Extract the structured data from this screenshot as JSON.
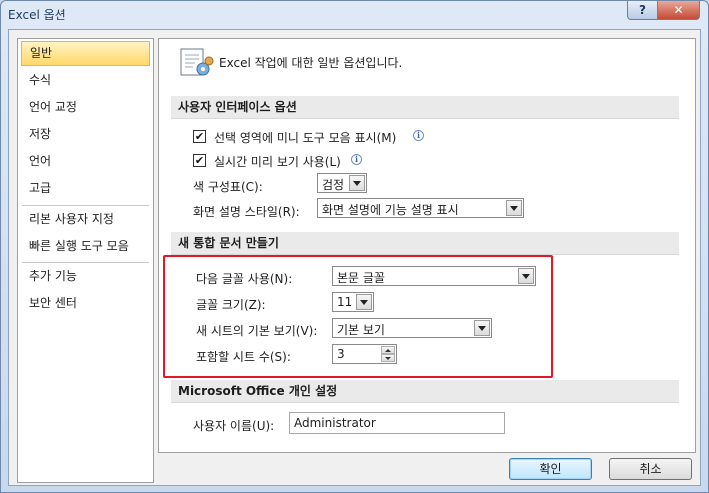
{
  "window": {
    "title": "Excel 옵션",
    "help_label": "?",
    "close_label": "✕"
  },
  "sidebar": {
    "items": [
      {
        "label": "일반",
        "selected": true
      },
      {
        "label": "수식"
      },
      {
        "label": "언어 교정"
      },
      {
        "label": "저장"
      },
      {
        "label": "언어"
      },
      {
        "label": "고급"
      },
      {
        "label": "리본 사용자 지정"
      },
      {
        "label": "빠른 실행 도구 모음"
      },
      {
        "label": "추가 기능"
      },
      {
        "label": "보안 센터"
      }
    ]
  },
  "main": {
    "intro": "Excel 작업에 대한 일반 옵션입니다.",
    "ui_section": {
      "title": "사용자 인터페이스 옵션",
      "mini_toolbar": {
        "label": "선택 영역에 미니 도구 모음 표시(M)",
        "checked": true
      },
      "live_preview": {
        "label": "실시간 미리 보기 사용(L)",
        "checked": true
      },
      "color_scheme": {
        "label": "색 구성표(C):",
        "value": "검정"
      },
      "screentip": {
        "label": "화면 설명 스타일(R):",
        "value": "화면 설명에 기능 설명 표시"
      }
    },
    "new_wb_section": {
      "title": "새 통합 문서 만들기",
      "font": {
        "label": "다음 글꼴 사용(N):",
        "value": "본문 글꼴"
      },
      "size": {
        "label": "글꼴 크기(Z):",
        "value": "11"
      },
      "view": {
        "label": "새 시트의 기본 보기(V):",
        "value": "기본 보기"
      },
      "sheets": {
        "label": "포함할 시트 수(S):",
        "value": "3"
      }
    },
    "personalize_section": {
      "title": "Microsoft Office 개인 설정",
      "username": {
        "label": "사용자 이름(U):",
        "value": "Administrator"
      }
    }
  },
  "footer": {
    "ok_label": "확인",
    "cancel_label": "취소"
  },
  "colors": {
    "highlight": "#e0182a",
    "selected_item": "#ffd86a"
  }
}
